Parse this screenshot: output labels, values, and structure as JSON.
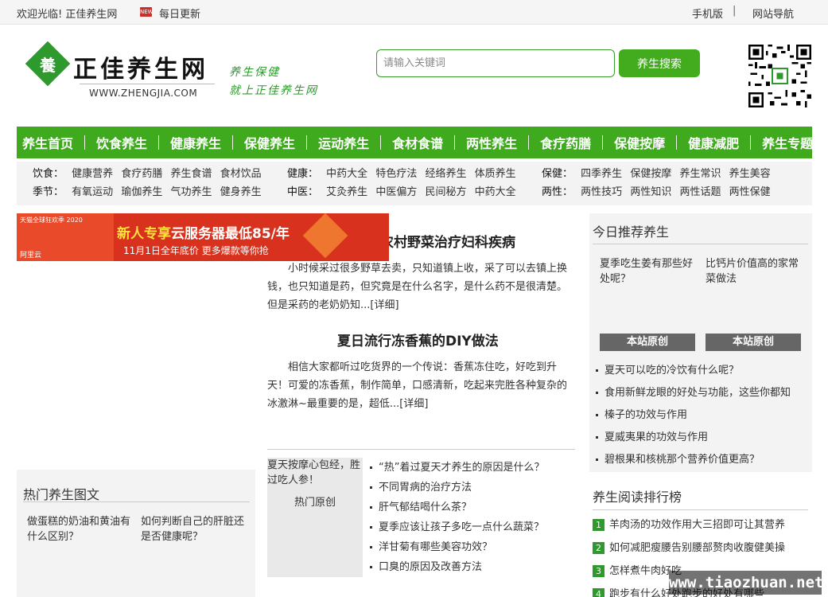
{
  "topbar": {
    "welcome": "欢迎光临! 正佳养生网",
    "new_badge": "NEW",
    "daily_update": "每日更新",
    "mobile": "手机版",
    "separator": "|",
    "site_nav": "网站导航"
  },
  "header": {
    "logo_char": "養",
    "logo_name": "正佳养生网",
    "logo_domain": "WWW.ZHENGJIA.COM",
    "slogan_line1": "养生保健",
    "slogan_line2": "就上正佳养生网",
    "search_placeholder": "请输入关键词",
    "search_button": "养生搜索",
    "brand_color": "#3faa1e"
  },
  "main_nav": [
    "养生首页",
    "饮食养生",
    "健康养生",
    "保健养生",
    "运动养生",
    "食材食谱",
    "两性养生",
    "食疗药膳",
    "保健按摩",
    "健康减肥",
    "养生专题"
  ],
  "sub_nav": {
    "diet": {
      "label": "饮食：",
      "links": [
        "健康营养",
        "食疗药膳",
        "养生食谱",
        "食材饮品"
      ]
    },
    "season": {
      "label": "季节：",
      "links": [
        "有氧运动",
        "瑜伽养生",
        "气功养生",
        "健身养生"
      ]
    },
    "health": {
      "label": "健康：",
      "links": [
        "中药大全",
        "特色疗法",
        "经络养生",
        "体质养生"
      ]
    },
    "tcm": {
      "label": "中医：",
      "links": [
        "艾灸养生",
        "中医偏方",
        "民间秘方",
        "中药大全"
      ]
    },
    "care": {
      "label": "保健：",
      "links": [
        "四季养生",
        "保健按摩",
        "养生常识",
        "养生美容"
      ]
    },
    "sex": {
      "label": "两性：",
      "links": [
        "两性技巧",
        "两性知识",
        "两性话题",
        "两性保健"
      ]
    }
  },
  "ad": {
    "brand": "天猫全球狂欢季 2020",
    "aliyun": "阿里云",
    "headline_prefix": "新人专享",
    "headline_rest": "云服务器最低85/年",
    "sub": "11月1日全年底价 更多爆款等你抢"
  },
  "articles": [
    {
      "title": "民间偏方：农村野菜治疗妇科疾病",
      "body": "小时候采过很多野草去卖，只知道镇上收，采了可以去镇上换钱，也只知道是药，但究竟是在什么名字，是什么药不是很清楚。但是采药的老奶奶知...",
      "more": "[详细]"
    },
    {
      "title": "夏日流行冻香蕉的DIY做法",
      "body": "相信大家都听过吃货界的一个传说：香蕉冻住吃，好吃到升天！可爱的冻香蕉，制作简单，口感清新，吃起来完胜各种复杂的冰激淋~最重要的是，超低...",
      "more": "[详细]"
    }
  ],
  "hot_original": {
    "image_alt": "夏天按摩心包经，胜过吃人参！",
    "caption": "热门原创",
    "list": [
      "“热”着过夏天才养生的原因是什么？",
      "不同胃病的治疗方法",
      "肝气郁结喝什么茶？",
      "夏季应该让孩子多吃一点什么蔬菜？",
      "洋甘菊有哪些美容功效？",
      "口臭的原因及改善方法"
    ]
  },
  "hot_pics": {
    "header": "热门养生图文",
    "items": [
      "做蛋糕的奶油和黄油有什么区别？",
      "如何判断自己的肝脏还是否健康呢？"
    ]
  },
  "today": {
    "header": "今日推荐养生",
    "images": [
      "夏季吃生姜有那些好处呢？",
      "比钙片价值高的家常菜做法"
    ],
    "tags": [
      "本站原创",
      "本站原创"
    ],
    "list": [
      "夏天可以吃的冷饮有什么呢？",
      "食用新鲜龙眼的好处与功能，这些你都知",
      "榛子的功效与作用",
      "夏威夷果的功效与作用",
      "碧根果和核桃那个营养价值更高？"
    ]
  },
  "ranking": {
    "header": "养生阅读排行榜",
    "items": [
      {
        "num": "1",
        "text": "羊肉汤的功效作用大三招即可让其营养"
      },
      {
        "num": "2",
        "text": "如何减肥瘦腰告别腰部赘肉收腹健美操"
      },
      {
        "num": "3",
        "text": "怎样煮牛肉好吃"
      },
      {
        "num": "4",
        "text": "跑步有什么好处跑步的好处有哪些"
      }
    ]
  },
  "watermark": "www.tiaozhuan.net"
}
